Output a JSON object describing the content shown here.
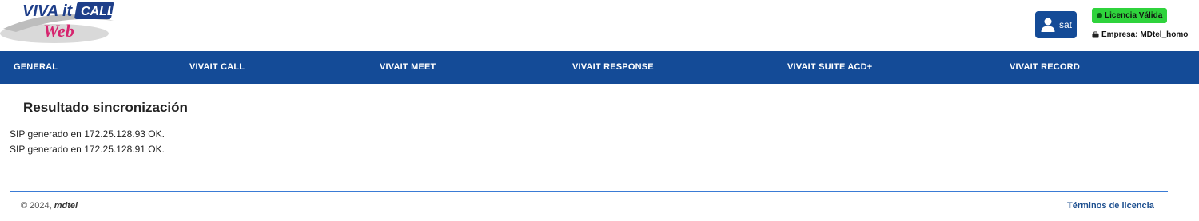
{
  "header": {
    "logo": {
      "line1_part1": "VIVA",
      "line1_part2": "it",
      "line1_part3": "CALL",
      "line2": "Web"
    },
    "user_button_label": "sat",
    "license_badge": "Licencia Válida",
    "empresa_label": "Empresa: MDtel_homo"
  },
  "nav": {
    "items": [
      {
        "label": "GENERAL"
      },
      {
        "label": "VIVAIT CALL"
      },
      {
        "label": "VIVAIT MEET"
      },
      {
        "label": "VIVAIT RESPONSE"
      },
      {
        "label": "VIVAIT SUITE ACD+"
      },
      {
        "label": "VIVAIT RECORD"
      }
    ]
  },
  "main": {
    "title": "Resultado sincronización",
    "results": [
      "SIP generado en 172.25.128.93 OK.",
      "SIP generado en 172.25.128.91 OK."
    ]
  },
  "footer": {
    "copyright_prefix": "© 2024,",
    "company": "mdtel",
    "terms_link": "Términos de licencia"
  },
  "colors": {
    "primary": "#144b97",
    "license_green": "#2fd33c",
    "logo_pink": "#d6246e",
    "footer_rule": "#3a7bd5"
  }
}
